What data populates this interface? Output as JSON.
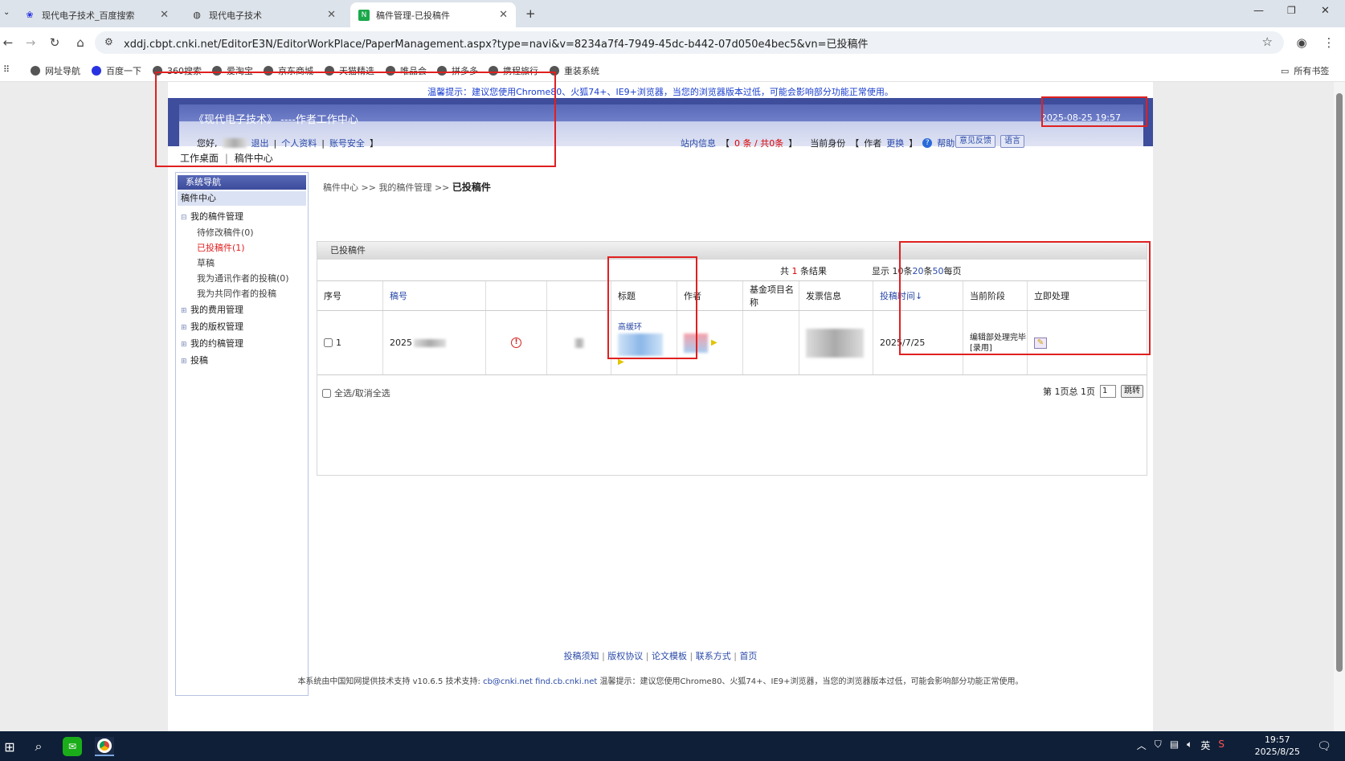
{
  "browser": {
    "tabs": [
      {
        "label": "现代电子技术_百度搜索",
        "icon": "baidu-paw-icon"
      },
      {
        "label": "现代电子技术",
        "icon": "globe-icon"
      },
      {
        "label": "稿件管理-已投稿件",
        "icon": "cnki-icon",
        "active": true
      }
    ],
    "url": "xddj.cbpt.cnki.net/EditorE3N/EditorWorkPlace/PaperManagement.aspx?type=navi&v=8234a7f4-7949-45dc-b442-07d050e4bec5&vn=已投稿件",
    "bookmarks": [
      "网址导航",
      "百度一下",
      "360搜索",
      "爱淘宝",
      "京东商城",
      "天猫精选",
      "唯品会",
      "拼多多",
      "携程旅行",
      "重装系统"
    ],
    "all_bookmarks": "所有书签"
  },
  "page": {
    "tip": "温馨提示：建议您使用Chrome80、火狐74+、IE9+浏览器，当您的浏览器版本过低，可能会影响部分功能正常使用。",
    "journal": "《现代电子技术》 ----作者工作中心",
    "datetime": "2025-08-25 19:57",
    "greeting": "您好,",
    "logout": "退出",
    "profile": "个人资料",
    "account": "账号安全",
    "site_msg": "站内信息",
    "msg_count": "0 条 / 共0条",
    "identity_label": "当前身份",
    "identity": "作者",
    "switch": "更换",
    "help": "帮助",
    "feedback": "意见反馈",
    "language": "语言",
    "workdesk": "工作桌面",
    "manuscript_center": "稿件中心"
  },
  "sidebar": {
    "title": "系统导航",
    "center": "稿件中心",
    "groups": [
      {
        "label": "我的稿件管理",
        "items": [
          "待修改稿件(0)",
          "已投稿件(1)",
          "草稿",
          "我为通讯作者的投稿(0)",
          "我为共同作者的投稿"
        ]
      },
      {
        "label": "我的费用管理"
      },
      {
        "label": "我的版权管理"
      },
      {
        "label": "我的约稿管理"
      },
      {
        "label": "投稿"
      }
    ]
  },
  "main": {
    "breadcrumb": [
      "稿件中心",
      ">>",
      "我的稿件管理",
      ">>",
      "已投稿件"
    ],
    "panel_title": "已投稿件",
    "result_total_pre": "共",
    "result_total": "1",
    "result_total_post": "条结果",
    "show_pre": "显示",
    "show_10": "10条",
    "show_20": "20",
    "show_mid": "条",
    "show_50": "50",
    "show_post": "每页",
    "columns": [
      "序号",
      "稿号",
      "",
      "",
      "标题",
      "作者",
      "基金项目名称",
      "发票信息",
      "投稿时间↓",
      "当前阶段",
      "立即处理"
    ],
    "row": {
      "index": "1",
      "number": "2025",
      "date": "2025/7/25",
      "stage": "编辑部处理完毕[录用]",
      "title_partial": "高缓环"
    },
    "select_all": "全选/取消全选",
    "pager_text": "第 1页总 1页",
    "pager_input": "1",
    "pager_button": "跳转"
  },
  "footer": {
    "links": [
      "投稿须知",
      "版权协议",
      "论文模板",
      "联系方式",
      "首页"
    ],
    "note_pre": "本系统由中国知网提供技术支持 v10.6.5 技术支持:",
    "email": "cb@cnki.net",
    "find": "find.cb.cnki.net",
    "note_post": "温馨提示：建议您使用Chrome80、火狐74+、IE9+浏览器，当您的浏览器版本过低，可能会影响部分功能正常使用。"
  },
  "taskbar": {
    "time": "19:57",
    "date": "2025/8/25",
    "ime": "英"
  }
}
